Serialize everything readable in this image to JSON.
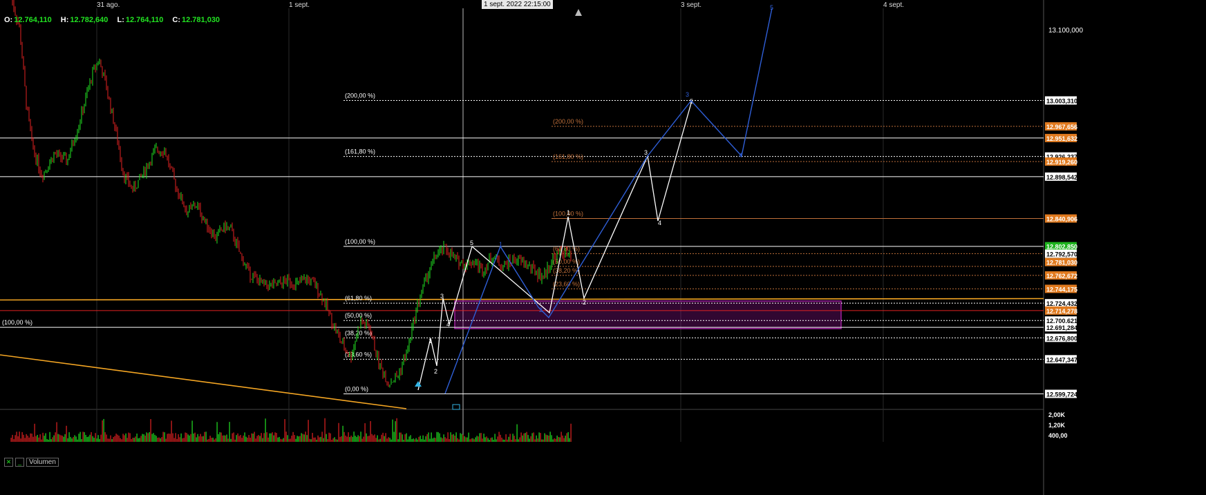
{
  "ohlc": {
    "open_label": "O:",
    "open": "12.764,110",
    "high_label": "H:",
    "high": "12.782,640",
    "low_label": "L:",
    "low": "12.764,110",
    "close_label": "C:",
    "close": "12.781,030"
  },
  "cursor_date": "1 sept. 2022 22:15:00",
  "volume_legend": {
    "close_icon": "✕",
    "minimize_icon": "_",
    "label": "Volumen"
  },
  "colors": {
    "background": "#000000",
    "bull": "#22e322",
    "bear": "#e32222",
    "fib_white": "#ffffff",
    "fib_orange": "#c0703a",
    "trendline": "#f5a623",
    "wave_blue": "#2f5fd8",
    "zone": "#a020a0",
    "current_price": "#1fb41f"
  },
  "chart_data": {
    "type": "candlestick",
    "title": "",
    "x_tick_labels": [
      "31 ago.",
      "1 sept.",
      "3 sept.",
      "4 sept."
    ],
    "y_tick_labels": [
      "13.100,000"
    ],
    "y_range": [
      12590,
      13180
    ],
    "close_series": [
      [
        0.0,
        13150
      ],
      [
        0.3,
        13100
      ],
      [
        0.5,
        13000
      ],
      [
        0.7,
        12940
      ],
      [
        1.0,
        12900
      ],
      [
        1.4,
        12930
      ],
      [
        1.8,
        12920
      ],
      [
        2.2,
        12975
      ],
      [
        2.6,
        13040
      ],
      [
        2.8,
        13060
      ],
      [
        3.0,
        13030
      ],
      [
        3.3,
        12970
      ],
      [
        3.6,
        12900
      ],
      [
        3.9,
        12880
      ],
      [
        4.3,
        12910
      ],
      [
        4.6,
        12935
      ],
      [
        4.9,
        12935
      ],
      [
        5.1,
        12905
      ],
      [
        5.3,
        12880
      ],
      [
        5.6,
        12850
      ],
      [
        5.9,
        12860
      ],
      [
        6.2,
        12835
      ],
      [
        6.5,
        12815
      ],
      [
        6.8,
        12830
      ],
      [
        7.0,
        12825
      ],
      [
        7.3,
        12790
      ],
      [
        7.6,
        12765
      ],
      [
        8.0,
        12750
      ],
      [
        8.4,
        12748
      ],
      [
        8.8,
        12756
      ],
      [
        9.1,
        12750
      ],
      [
        9.4,
        12758
      ],
      [
        9.7,
        12748
      ],
      [
        9.95,
        12728
      ],
      [
        10.2,
        12700
      ],
      [
        10.5,
        12670
      ],
      [
        10.8,
        12650
      ],
      [
        11.1,
        12700
      ],
      [
        11.4,
        12690
      ],
      [
        11.7,
        12640
      ],
      [
        12.0,
        12615
      ],
      [
        12.3,
        12625
      ],
      [
        12.6,
        12660
      ],
      [
        12.9,
        12720
      ],
      [
        13.2,
        12760
      ],
      [
        13.5,
        12790
      ],
      [
        13.8,
        12800
      ],
      [
        14.1,
        12785
      ],
      [
        14.4,
        12778
      ],
      [
        14.7,
        12782
      ],
      [
        15.0,
        12770
      ],
      [
        15.3,
        12790
      ],
      [
        15.6,
        12775
      ],
      [
        16.0,
        12785
      ],
      [
        16.3,
        12780
      ],
      [
        16.6,
        12770
      ],
      [
        16.9,
        12760
      ],
      [
        17.2,
        12785
      ],
      [
        17.5,
        12795
      ],
      [
        17.8,
        12786
      ]
    ],
    "volume_axis_labels": [
      "2,00K",
      "1,20K",
      "400,00"
    ],
    "fib_levels_white": [
      {
        "label": "(0,00 %)",
        "value": "12.599,724"
      },
      {
        "label": "(23,60 %)",
        "value": "12.647,347"
      },
      {
        "label": "(38,20 %)",
        "value": "12.676,800"
      },
      {
        "label": "(50,00 %)",
        "value": "12.700,621"
      },
      {
        "label": "(61,80 %)",
        "value": "12.724,432"
      },
      {
        "label": "(100,00 %)",
        "value": "12.802,570"
      },
      {
        "label": "(161,80 %)",
        "value": "12.926,237"
      },
      {
        "label": "(200,00 %)",
        "value": "13.003,310"
      }
    ],
    "fib_levels_orange": [
      {
        "label": "(23,60 %)",
        "value": "12.744,175"
      },
      {
        "label": "(38,20 %)",
        "value": "12.762,672"
      },
      {
        "label": "(50,00 %)",
        "value": "12.775,000"
      },
      {
        "label": "(61,80 %)",
        "value": "12.792,570"
      },
      {
        "label": "(100,00 %)",
        "value": "12.840,906"
      },
      {
        "label": "(161,80 %)",
        "value": "12.919,260"
      },
      {
        "label": "(200,00 %)",
        "value": "12.967,656"
      }
    ],
    "left_fib_label": "(100,00 %)",
    "horizontal_lines": [
      {
        "value": "12.898,542",
        "color": "#ffffff"
      },
      {
        "value": "12.951,632",
        "color": "#ffffff"
      },
      {
        "value": "12.691,284",
        "color": "#ffffff"
      },
      {
        "value": "12.714,278",
        "color": "#e32222"
      }
    ],
    "price_tags": [
      {
        "text": "13.003,310",
        "style": "white"
      },
      {
        "text": "12.967,656",
        "style": "orange"
      },
      {
        "text": "12.951,632",
        "style": "orange"
      },
      {
        "text": "12.926,237",
        "style": "white"
      },
      {
        "text": "12.919,260",
        "style": "orange"
      },
      {
        "text": "12.898,542",
        "style": "white"
      },
      {
        "text": "12.840,906",
        "style": "orange"
      },
      {
        "text": "12.802,850",
        "style": "green"
      },
      {
        "text": "12.792,570",
        "style": "white"
      },
      {
        "text": "12.781,030",
        "style": "orange"
      },
      {
        "text": "12.762,672",
        "style": "orange"
      },
      {
        "text": "12.744,175",
        "style": "orange"
      },
      {
        "text": "12.724,432",
        "style": "white"
      },
      {
        "text": "12.714,278",
        "style": "orange"
      },
      {
        "text": "12.700,621",
        "style": "white"
      },
      {
        "text": "12.691,284",
        "style": "white"
      },
      {
        "text": "12.676,800",
        "style": "white"
      },
      {
        "text": "12.647,347",
        "style": "white"
      },
      {
        "text": "12.599,724",
        "style": "white"
      }
    ],
    "wave_labels_white": [
      "1",
      "2",
      "3",
      "4",
      "5",
      "1",
      "2",
      "3",
      "4",
      "5"
    ],
    "wave_labels_blue": [
      "1",
      "2",
      "3",
      "4",
      "5"
    ]
  }
}
